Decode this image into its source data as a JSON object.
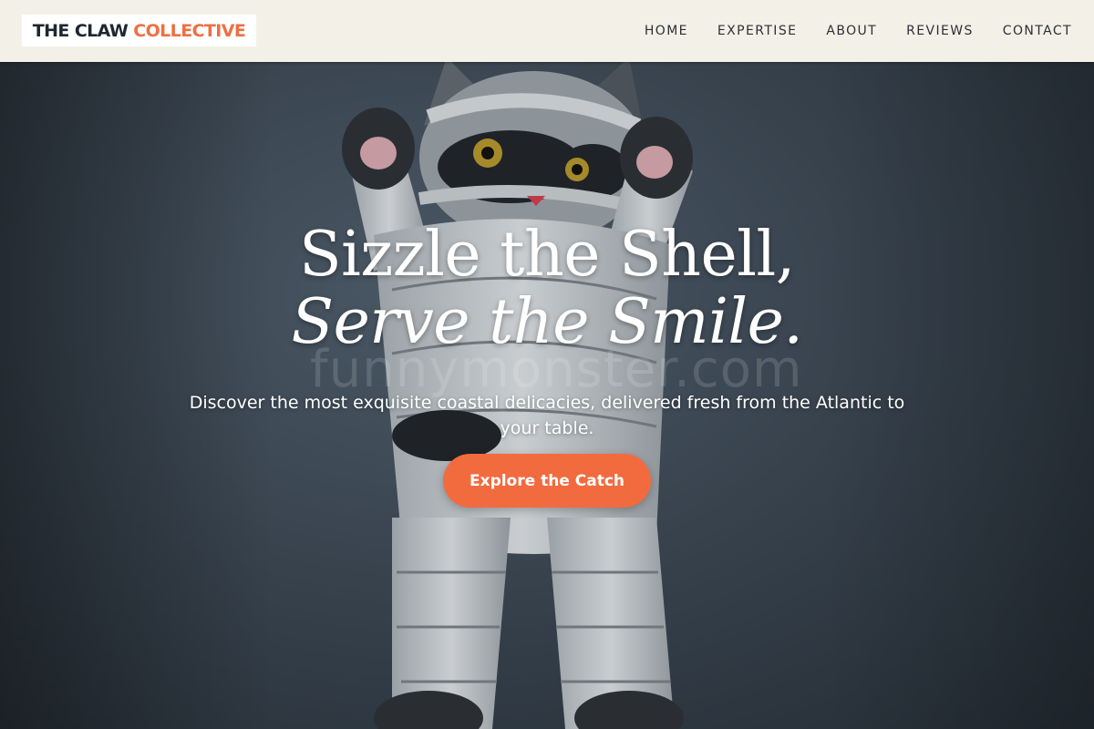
{
  "brand": {
    "part1": "THE CLAW",
    "part2": "COLLECTIVE"
  },
  "nav": {
    "items": [
      {
        "label": "HOME"
      },
      {
        "label": "EXPERTISE"
      },
      {
        "label": "ABOUT"
      },
      {
        "label": "REVIEWS"
      },
      {
        "label": "CONTACT"
      }
    ]
  },
  "hero": {
    "headline_line1": "Sizzle the Shell,",
    "headline_line2": "Serve the Smile.",
    "subtitle": "Discover the most exquisite coastal delicacies, delivered fresh from the Atlantic to your table.",
    "cta_label": "Explore the Catch",
    "watermark": "funnymonster.com"
  },
  "colors": {
    "accent": "#f26b3f",
    "header_bg": "#f3f1e7",
    "logo_dark": "#1e2731"
  }
}
